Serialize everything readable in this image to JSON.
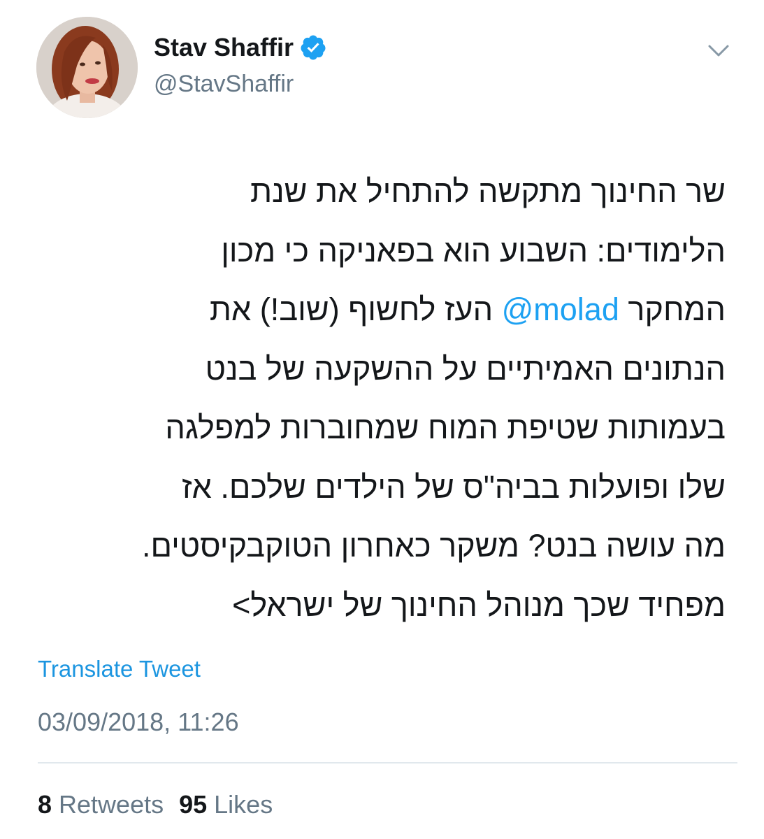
{
  "author": {
    "display_name": "Stav Shaffir",
    "handle": "@StavShaffir",
    "verified_icon": "verified-badge-icon",
    "menu_icon": "chevron-down-icon"
  },
  "tweet": {
    "lines": [
      {
        "before": "שר החינוך מתקשה להתחיל את שנת",
        "mention": "",
        "after": ""
      },
      {
        "before": "הלימודים: השבוע הוא בפאניקה כי מכון",
        "mention": "",
        "after": ""
      },
      {
        "before": "המחקר ",
        "mention": "@molad",
        "after": " העז לחשוף (שוב!) את"
      },
      {
        "before": "הנתונים האמיתיים על ההשקעה של בנט",
        "mention": "",
        "after": ""
      },
      {
        "before": "בעמותות שטיפת המוח שמחוברות למפלגה",
        "mention": "",
        "after": ""
      },
      {
        "before": "שלו ופועלות בביה\"ס של הילדים שלכם. אז",
        "mention": "",
        "after": ""
      },
      {
        "before": "מה עושה בנט? משקר כאחרון הטוקבקיסטים.",
        "mention": "",
        "after": ""
      },
      {
        "before": "מפחיד שכך מנוהל החינוך של ישראל>",
        "mention": "",
        "after": ""
      }
    ],
    "translate_label": "Translate Tweet",
    "timestamp": "03/09/2018, 11:26"
  },
  "stats": {
    "retweets_count": "8",
    "retweets_label": "Retweets",
    "likes_count": "95",
    "likes_label": "Likes"
  },
  "colors": {
    "link": "#1da1f2",
    "secondary_text": "#657786",
    "primary_text": "#14171a",
    "divider": "#e1e8ed",
    "verified": "#1da1f2"
  }
}
